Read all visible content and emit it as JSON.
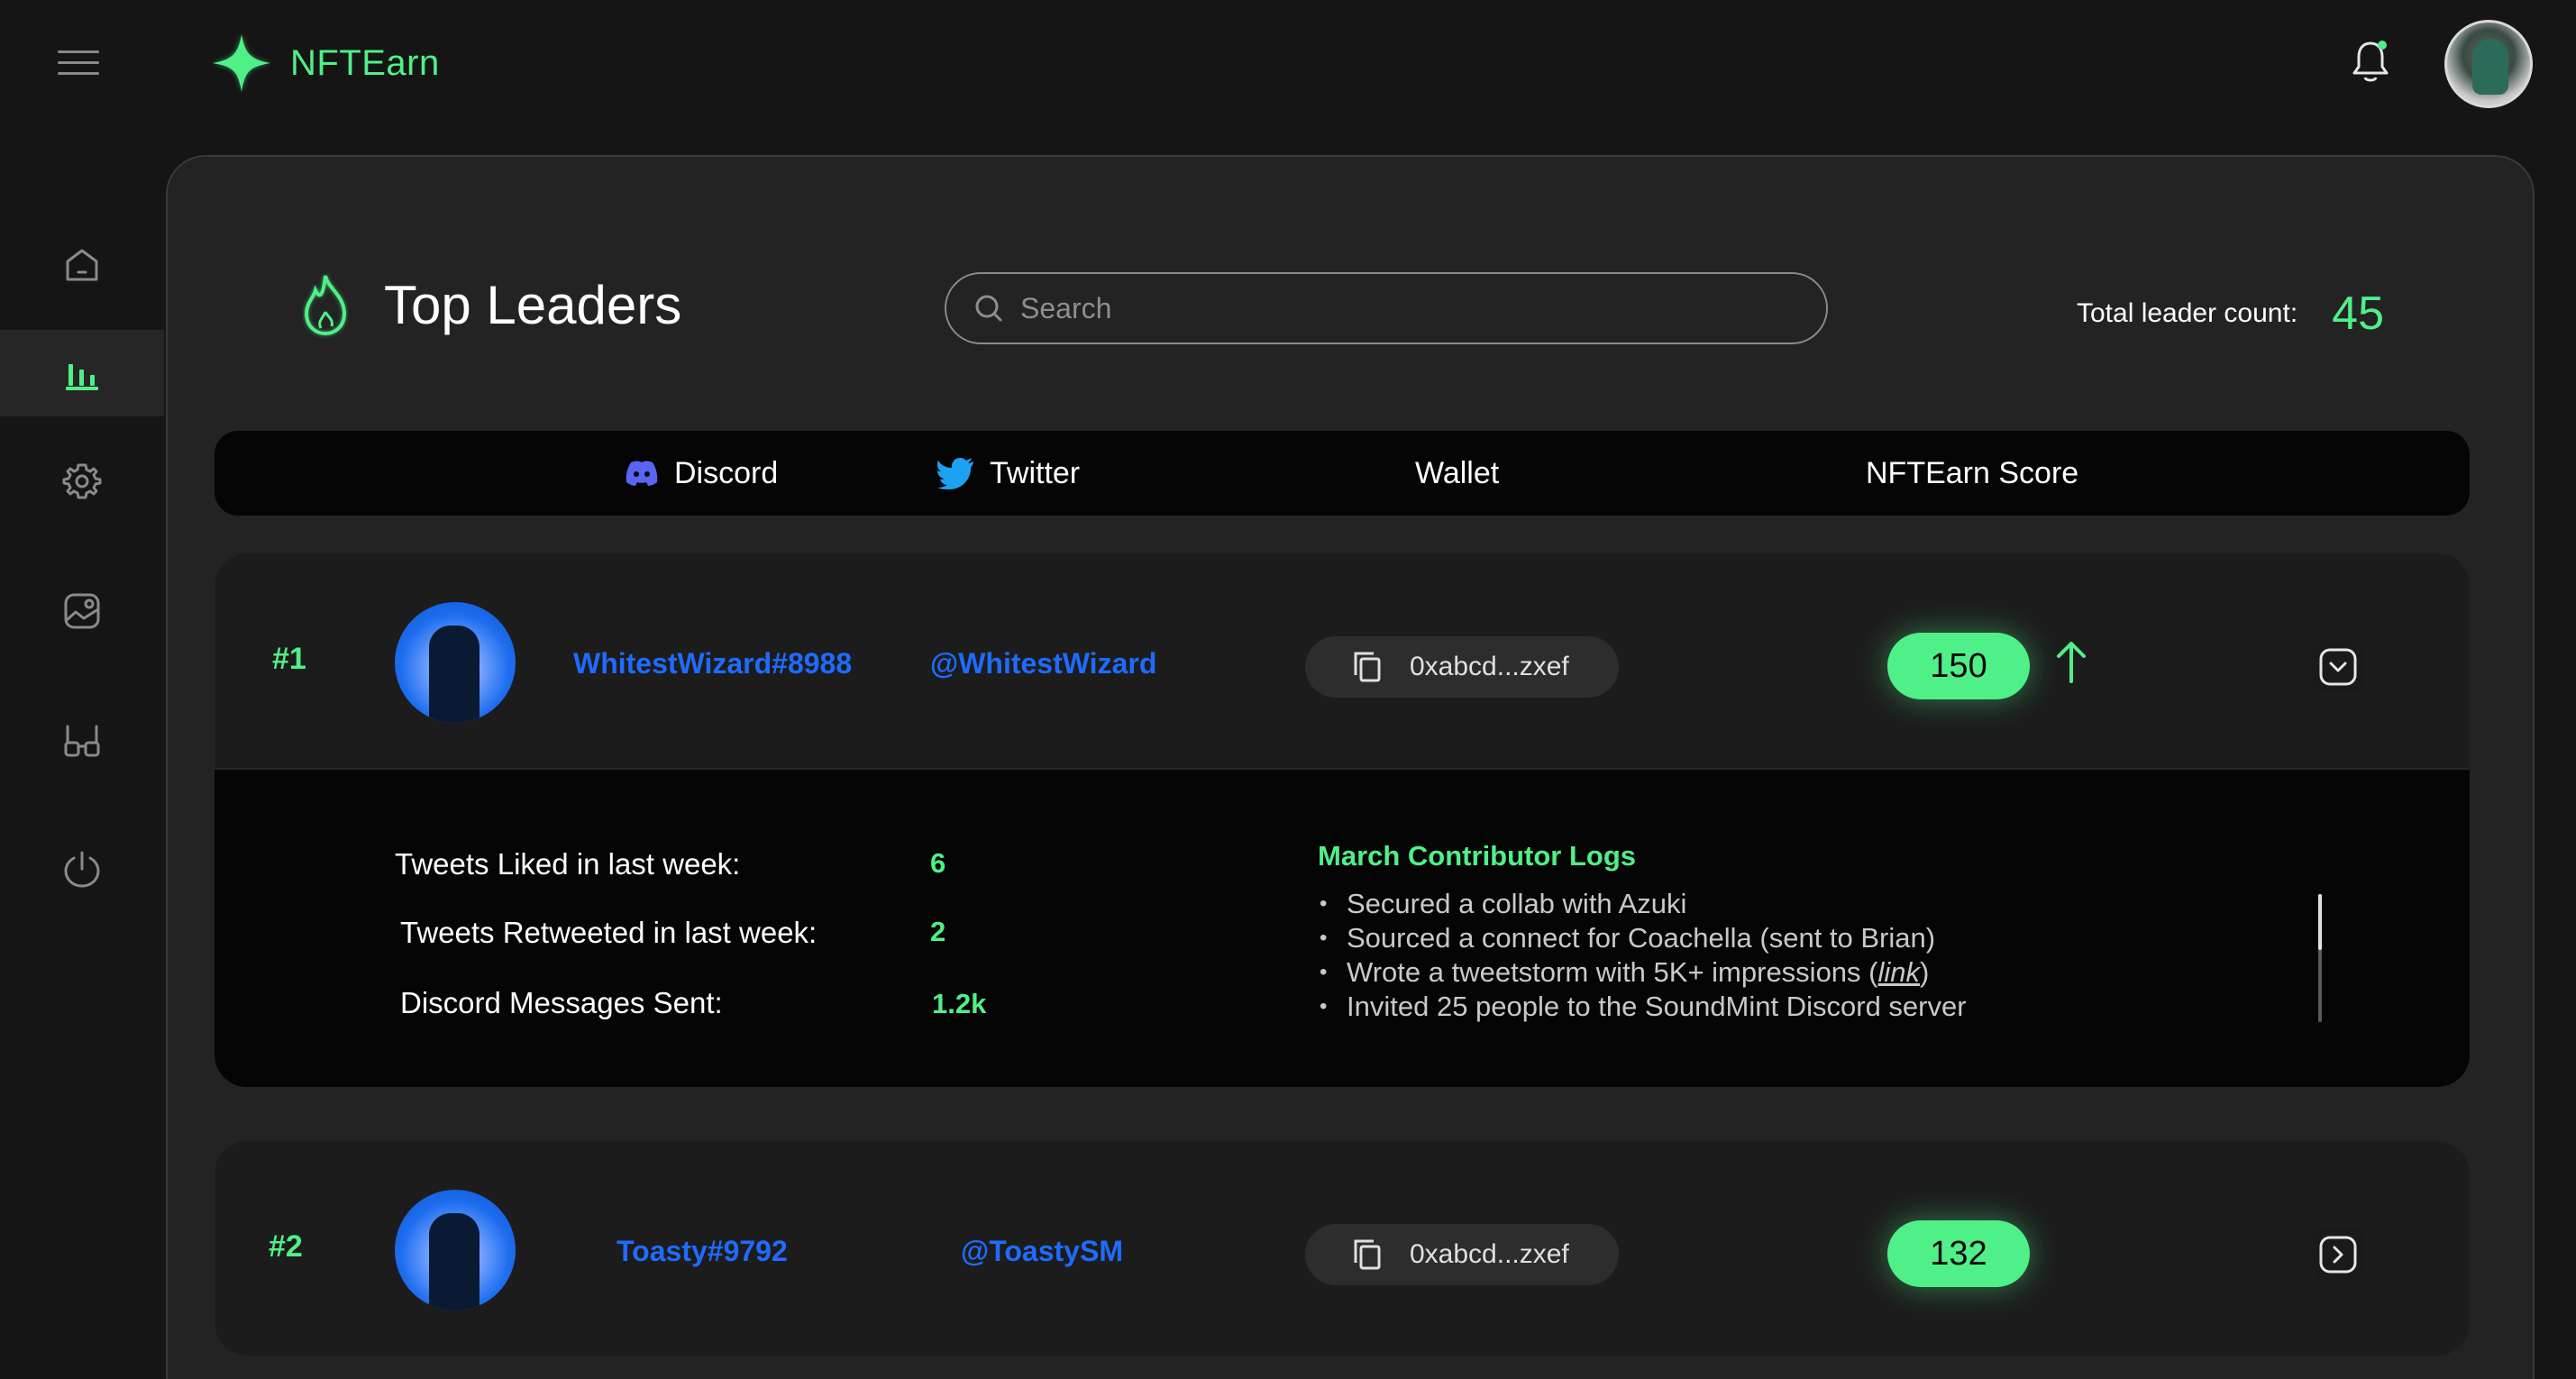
{
  "app": {
    "name": "NFTEarn",
    "accent": "#4ff087",
    "link_color": "#1f6bff"
  },
  "topbar": {
    "menu_icon": "hamburger-icon",
    "logo_icon": "sparkle-star-icon",
    "bell_icon": "bell-icon",
    "avatar": "user-avatar"
  },
  "sidebar": {
    "items": [
      {
        "icon": "home-icon",
        "active": false
      },
      {
        "icon": "bar-chart-icon",
        "active": true
      },
      {
        "icon": "gear-icon",
        "active": false
      },
      {
        "icon": "image-icon",
        "active": false
      },
      {
        "icon": "glasses-icon",
        "active": false
      },
      {
        "icon": "power-icon",
        "active": false
      }
    ]
  },
  "page": {
    "title": "Top Leaders",
    "title_icon": "flame-icon",
    "search_placeholder": "Search",
    "total_label": "Total leader count:",
    "total_value": "45"
  },
  "columns": {
    "discord": "Discord",
    "twitter": "Twitter",
    "wallet": "Wallet",
    "score": "NFTEarn Score"
  },
  "leaders": [
    {
      "rank": "#1",
      "discord": "WhitestWizard#8988",
      "twitter": "@WhitestWizard",
      "wallet": "0xabcd...zxef",
      "score": "150",
      "trend": "up",
      "expanded": true,
      "stats": [
        {
          "label": "Tweets Liked in last week:",
          "value": "6"
        },
        {
          "label": "Tweets Retweeted in last week:",
          "value": "2"
        },
        {
          "label": "Discord Messages Sent:",
          "value": "1.2k"
        }
      ],
      "logs_title": "March Contributor Logs",
      "logs": [
        "Secured a collab with Azuki",
        "Sourced a connect for Coachella (sent to Brian)",
        "Wrote a tweetstorm with 5K+ impressions",
        "Invited 25 people to the SoundMint Discord server"
      ],
      "log_link_text": "link"
    },
    {
      "rank": "#2",
      "discord": "Toasty#9792",
      "twitter": "@ToastySM",
      "wallet": "0xabcd...zxef",
      "score": "132",
      "expanded": false
    }
  ]
}
